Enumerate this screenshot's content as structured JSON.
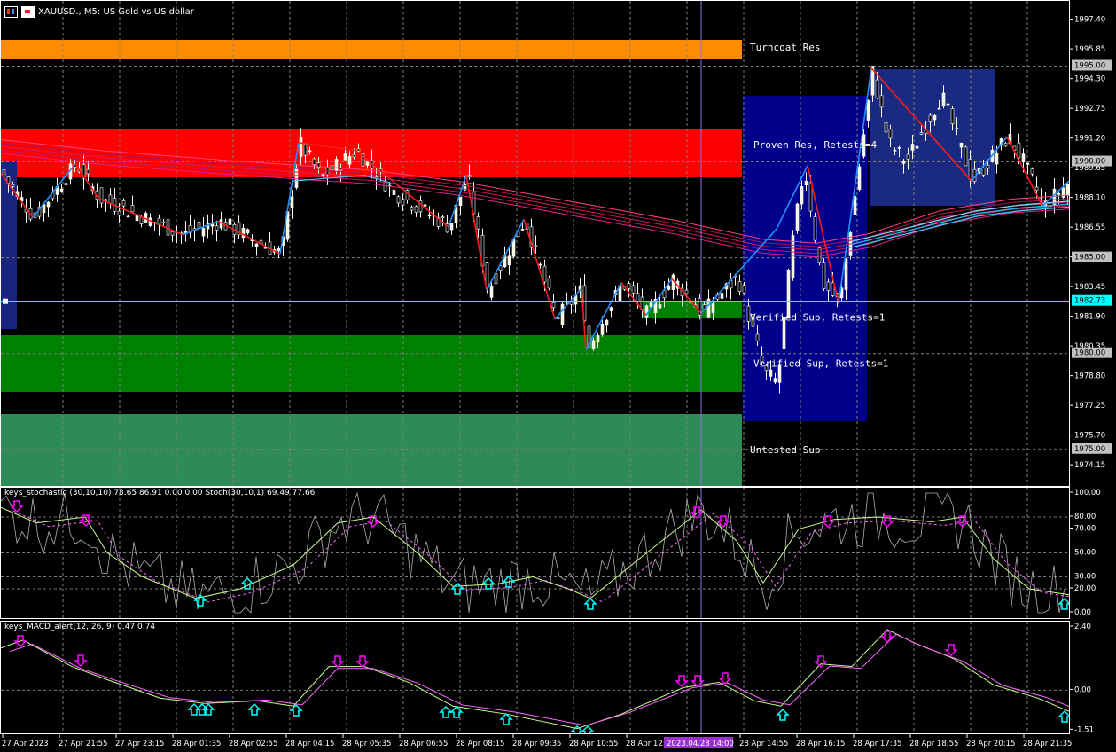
{
  "chart": {
    "symbol_title": "XAUUSD., M5:  US Gold vs US dollar",
    "price_axis_ticks": [
      "1997.40",
      "1995.85",
      "1994.30",
      "1992.75",
      "1991.20",
      "1989.65",
      "1988.10",
      "1986.55",
      "1985.00",
      "1983.45",
      "1981.90",
      "1980.35",
      "1978.80",
      "1977.25",
      "1975.70",
      "1974.15"
    ],
    "price_axis_range": [
      1973.0,
      1998.4
    ],
    "price_labels": [
      {
        "price": 1995.0,
        "text": "1995.00",
        "color": "#c0c0c0",
        "text_color": "#000000"
      },
      {
        "price": 1990.0,
        "text": "1990.00",
        "color": "#c0c0c0",
        "text_color": "#000000"
      },
      {
        "price": 1985.0,
        "text": "1985.00",
        "color": "#c0c0c0",
        "text_color": "#000000"
      },
      {
        "price": 1982.73,
        "text": "1982.73",
        "color": "#00ffff",
        "text_color": "#000000"
      },
      {
        "price": 1980.0,
        "text": "1980.00",
        "color": "#c0c0c0",
        "text_color": "#000000"
      },
      {
        "price": 1975.0,
        "text": "1975.00",
        "color": "#c0c0c0",
        "text_color": "#000000"
      }
    ],
    "zone_labels": [
      {
        "text": "Turncoat Res",
        "price": 1996.0
      },
      {
        "text": "Proven Res, Retests=4",
        "price": 1990.9
      },
      {
        "text": "Verified Sup, Retests=1",
        "price": 1981.9
      },
      {
        "text": "Verified Sup, Retests=1",
        "price": 1979.5
      },
      {
        "text": "Untested Sup",
        "price": 1975.0
      }
    ],
    "stoch_label": "keys_stochastic (30,10,10) 78.65 86.91 0.00 0.00 Stoch(30,10,1) 69.49 77.66",
    "stoch_axis_ticks": [
      "100.00",
      "80.00",
      "70.00",
      "50.00",
      "30.00",
      "20.00",
      "0.00"
    ],
    "macd_label": "keys_MACD_alert(12, 26, 9) 0.47 0.74",
    "macd_axis_ticks": [
      "2.40",
      "0.00",
      "-1.51"
    ],
    "time_axis_ticks": [
      "27 Apr 2023",
      "27 Apr 21:55",
      "27 Apr 23:15",
      "28 Apr 01:35",
      "28 Apr 02:55",
      "28 Apr 04:15",
      "28 Apr 05:35",
      "28 Apr 06:55",
      "28 Apr 08:15",
      "28 Apr 09:35",
      "28 Apr 10:55",
      "28 Apr 12:",
      "28 Apr 14:55",
      "28 Apr 16:15",
      "28 Apr 17:35",
      "28 Apr 18:55",
      "28 Apr 20:15",
      "28 Apr 21:35"
    ],
    "crosshair_time_label": "2023.04.28 14:00",
    "colors": {
      "turncoat_res": "#ff8c00",
      "proven_res": "#ff0000",
      "verified_sup": "#008000",
      "untested_sup": "#2e8b57",
      "blue_box": "#00008b",
      "bid_line": "#00ffff",
      "zigzag_up": "#1e90ff",
      "zigzag_down": "#ff1a1a",
      "arrow_down": "#ff00ff",
      "arrow_up": "#00ffff",
      "crosshair": "#9370db"
    }
  }
}
